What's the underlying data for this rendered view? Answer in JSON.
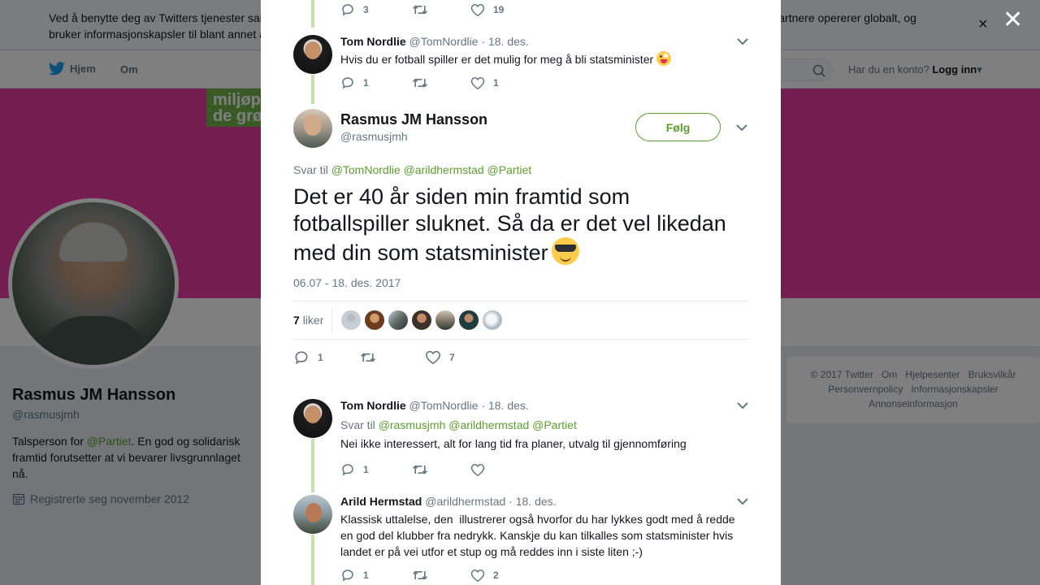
{
  "cookie_bar": {
    "text": "Ved å benytte deg av Twitters tjenester samtykker du i at vi og våre samarbeidspartnere bruker informasjonskapsler. Twitter og våre samarbeidspartnere opererer globalt, og bruker informasjonskapsler til blant annet analyse, tilpasning og annonser.",
    "close_label": "×"
  },
  "nav": {
    "home_label": "Hjem",
    "about_label": "Om",
    "account_prompt": "Har du en konto?",
    "login_label": "Logg inn"
  },
  "banner": {
    "logo_text": "miljøp de grø"
  },
  "profile": {
    "name": "Rasmus JM Hansson",
    "handle": "@rasmusjmh",
    "bio_prefix": "Talsperson for ",
    "bio_link": "@Partiet",
    "bio_suffix": ". En god og solidarisk framtid forutsetter at vi bevarer livsgrunnlaget nå.",
    "joined": "Registrerte seg november 2012"
  },
  "footer": {
    "copyright": "© 2017 Twitter",
    "about": "Om",
    "help": "Hjelpesenter",
    "terms": "Bruksvilkår",
    "privacy": "Personvernpolicy",
    "cookies": "Informasjonskapsler",
    "ads": "Annonseinformasjon"
  },
  "modal_close": "✕",
  "thread": {
    "top_actions": {
      "replies": "3",
      "retweets": "",
      "likes": "19"
    },
    "tweet1": {
      "name": "Tom Nordlie",
      "handle": "@TomNordlie",
      "date": "· 18. des.",
      "text": "Hvis du er fotball spiller er det mulig for meg å bli statsminister",
      "replies": "1",
      "likes": "1"
    },
    "main": {
      "name": "Rasmus JM Hansson",
      "handle": "@rasmusjmh",
      "follow_label": "Følg",
      "reply_prefix": "Svar til",
      "reply_handles": "@TomNordlie @arildhermstad @Partiet",
      "text": "Det er 40 år siden min framtid som fotballspiller sluknet. Så da er det vel likedan med din som statsminister",
      "timestamp": "06.07 - 18. des. 2017",
      "likes_count": "7",
      "likes_word": "liker",
      "replies": "1",
      "likes": "7"
    },
    "tweet2": {
      "name": "Tom Nordlie",
      "handle": "@TomNordlie",
      "date": "· 18. des.",
      "reply_prefix": "Svar til",
      "reply_handles": "@rasmusjmh @arildhermstad @Partiet",
      "text": "Nei ikke interessert, alt for lang tid fra planer, utvalg til gjennomføring",
      "replies": "1",
      "likes": ""
    },
    "tweet3": {
      "name": "Arild Hermstad",
      "handle": "@arildhermstad",
      "date": "· 18. des.",
      "text": "Klassisk uttalelse, den  illustrerer også hvorfor du har lykkes godt med å redde en god del klubber fra nedrykk. Kanskje du kan tilkalles som statsminister hvis landet er på vei utfor et stup og må reddes inn i siste liten ;-)",
      "replies": "1",
      "likes": "2"
    }
  },
  "colors": {
    "accent_green": "#5c9e2e",
    "banner_pink": "#e83aa3",
    "thread_line": "#c6e0b3"
  }
}
